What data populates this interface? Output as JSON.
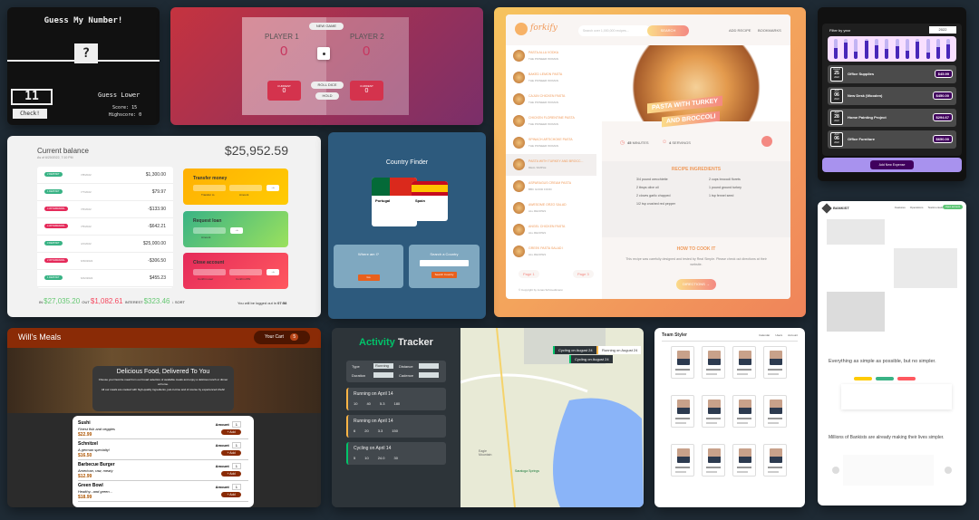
{
  "guess": {
    "title": "Guess My Number!",
    "mystery": "?",
    "input": "11",
    "again": "",
    "message": "Guess Lower",
    "score": "Score: 15",
    "highscore": "Highscore: 0",
    "check": "Check!"
  },
  "pig": {
    "new_game": "NEW GAME",
    "p1": "PLAYER 1",
    "p2": "PLAYER 2",
    "s1": "0",
    "s2": "0",
    "current": "CURRENT",
    "c1": "0",
    "c2": "0",
    "roll": "ROLL DICE",
    "hold": "HOLD"
  },
  "forkify": {
    "logo": "forkify",
    "search_placeholder": "Search over 1,000,000 recipes...",
    "search_btn": "SEARCH",
    "add_recipe": "ADD RECIPE",
    "bookmarks": "BOOKMARKS",
    "recipes": [
      {
        "t": "PASTA ALLA VODKA",
        "p": "THE PIONEER WOMAN"
      },
      {
        "t": "BAKED LEMON PASTA",
        "p": "THE PIONEER WOMAN"
      },
      {
        "t": "CAJUN CHICKEN PASTA",
        "p": "THE PIONEER WOMAN"
      },
      {
        "t": "CHICKEN FLORENTINE PASTA",
        "p": "THE PIONEER WOMAN"
      },
      {
        "t": "SPINACH ARTICHOKE PASTA",
        "p": "THE PIONEER WOMAN"
      },
      {
        "t": "PASTA WITH TURKEY AND BROCC...",
        "p": "REAL SIMPLE"
      },
      {
        "t": "ASPARAGUS CREAM PASTA",
        "p": "BBC GOOD FOOD"
      },
      {
        "t": "AWESOME ORZO SALAD",
        "p": "ALL RECIPES"
      },
      {
        "t": "ANGEL CHICKEN PASTA",
        "p": "ALL RECIPES"
      },
      {
        "t": "GREEK PASTA SALAD I",
        "p": "ALL RECIPES"
      }
    ],
    "page_prev": "Page 1",
    "page_next": "Page 3",
    "copyright": "© Copyright by Jonas Schmedtmann",
    "recipe_title_1": "PASTA WITH TURKEY",
    "recipe_title_2": "AND BROCCOLI",
    "minutes": "45",
    "minutes_label": "MINUTES",
    "servings": "4",
    "servings_label": "SERVINGS",
    "ing_title": "RECIPE INGREDIENTS",
    "ingredients": [
      "3/4 pound orecchiette",
      "2 cups broccoli florets",
      "2 tbsps olive oil",
      "1 pound ground turkey",
      "2 cloves garlic chopped",
      "1 tsp fennel seed",
      "1/2 tsp crushed red pepper"
    ],
    "howto": "HOW TO COOK IT",
    "howto_text": "This recipe was carefully designed and tested by Real Simple. Please check out directions at their website.",
    "directions": "DIRECTIONS →"
  },
  "budget": {
    "filter": "Filter by year",
    "year": "2022",
    "bars": [
      0.55,
      0.8,
      0.35,
      0.9,
      0.7,
      0.5,
      0.65,
      0.4,
      0.85,
      0.3,
      0.6,
      0.75
    ],
    "items": [
      {
        "m": "August",
        "d": "25",
        "y": "2022",
        "t": "Office Supplies",
        "v": "$45.99"
      },
      {
        "m": "April",
        "d": "06",
        "y": "2022",
        "t": "New Desk (Wooden)",
        "v": "$450.00"
      },
      {
        "m": "April",
        "d": "28",
        "y": "2022",
        "t": "Home Painting Project",
        "v": "$294.67"
      },
      {
        "m": "April",
        "d": "06",
        "y": "2022",
        "t": "Office Furniture",
        "v": "$650.00"
      }
    ],
    "add": "Add New Expense"
  },
  "bankist": {
    "balance_label": "Current balance",
    "balance_date": "As of 6/20/2022, 7:10 PM",
    "balance": "$25,952.59",
    "movements": [
      {
        "type": "2 DEPOSIT",
        "d": "7/8/2022",
        "v": "$1,300.00",
        "c": "#39b385"
      },
      {
        "type": "1 DEPOSIT",
        "d": "7/7/2022",
        "v": "$79.97",
        "c": "#39b385"
      },
      {
        "type": "4 WITHDRAWAL",
        "d": "7/6/2022",
        "v": "-$133.90",
        "c": "#e52a5a"
      },
      {
        "type": "4 WITHDRAWAL",
        "d": "7/5/2022",
        "v": "-$642.21",
        "c": "#e52a5a"
      },
      {
        "type": "3 DEPOSIT",
        "d": "4/1/2022",
        "v": "$25,000.00",
        "c": "#39b385"
      },
      {
        "type": "2 WITHDRAWAL",
        "d": "6/30/2022",
        "v": "-$306.50",
        "c": "#e52a5a"
      },
      {
        "type": "1 DEPOSIT",
        "d": "6/22/2022",
        "v": "$455.23",
        "c": "#39b385"
      }
    ],
    "in_label": "IN",
    "in": "$27,035.20",
    "out_label": "OUT",
    "out": "$1,082.61",
    "int_label": "INTEREST",
    "int": "$323.46",
    "sort": "↓ SORT",
    "logout": "You will be logged out in",
    "timer": "07:58",
    "transfer": "Transfer money",
    "transfer_to": "Transfer to",
    "amount": "Amount",
    "loan": "Request loan",
    "close": "Close account",
    "confirm_user": "Confirm user",
    "confirm_pin": "Confirm PIN"
  },
  "finder": {
    "title": "Country Finder",
    "country1": "Portugal",
    "country2": "Spain",
    "where": "Where am I?",
    "search": "Search a Country",
    "go": "Go",
    "search_btn": "Search Country"
  },
  "bankweb": {
    "logo": "BANKIST",
    "nav": [
      "Features",
      "Operations",
      "Testimonials"
    ],
    "cta": "Open account",
    "h1": "Everything as simple as possible, but no simpler.",
    "h2": "Millions of Bankists are already making their lives simpler."
  },
  "meals": {
    "title": "Will's Meals",
    "cart": "Your Cart",
    "cart_count": "5",
    "hero_title": "Delicious Food, Delivered To You",
    "hero_p1": "Choose your favorite meal from our broad selection of available meals and enjoy a delicious lunch or dinner at home.",
    "hero_p2": "All our meals are cooked with high-quality ingredients, just-in-time and of course by experienced chefs!",
    "items": [
      {
        "n": "Sushi",
        "d": "Finest fish and veggies",
        "p": "$22.99"
      },
      {
        "n": "Schnitzel",
        "d": "A german specialty!",
        "p": "$16.50"
      },
      {
        "n": "Barbecue Burger",
        "d": "American, raw, meaty",
        "p": "$12.99"
      },
      {
        "n": "Green Bowl",
        "d": "Healthy...and green...",
        "p": "$18.99"
      }
    ],
    "amount": "Amount",
    "qty": "1",
    "add": "+ Add"
  },
  "activity": {
    "title_a": "Activity",
    "title_b": "Tracker",
    "type": "Type",
    "type_val": "Running",
    "distance": "Distance",
    "duration": "Duration",
    "cadence": "Cadence",
    "workouts": [
      {
        "t": "Running on April 14",
        "km": "10",
        "min": "40",
        "pace": "5.3",
        "spm": "180",
        "c": "#ffb545"
      },
      {
        "t": "Running on April 14",
        "km": "6",
        "min": "20",
        "pace": "3.3",
        "spm": "150",
        "c": "#ffb545"
      },
      {
        "t": "Cycling on April 14",
        "km": "5",
        "min": "10",
        "pace": "24.0",
        "spm": "30",
        "c": "#00c46a"
      }
    ],
    "pop1": "Cycling on August 24",
    "pop2": "Running on August 24",
    "pop3": "Cycling on August 24",
    "map_label1": "Eagle Mountain",
    "map_label2": "Saratoga Springs"
  },
  "team": {
    "title": "Team Styler",
    "nav": [
      "Calendar",
      "Users",
      "Account"
    ]
  }
}
